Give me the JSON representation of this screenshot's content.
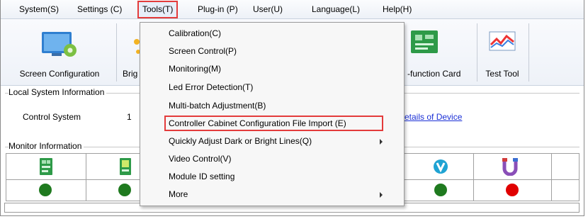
{
  "menubar": {
    "items": [
      "System(S)",
      "Settings (C)",
      "Tools(T)",
      "Plug-in (P)",
      "User(U)",
      "Language(L)",
      "Help(H)"
    ]
  },
  "toolbar": {
    "screen_configuration": "Screen Configuration",
    "brightness_partial": "Brig",
    "multifunction_partial": "-function Card",
    "test_tool": "Test Tool"
  },
  "local_system": {
    "title": "Local System Information",
    "control_system_label": "Control System",
    "control_system_value": "1",
    "details_link_partial": "etails of Device"
  },
  "monitor": {
    "title": "Monitor Information",
    "status_colors": [
      "#1f7a1f",
      "#1f7a1f",
      "#1f7a1f",
      "#e00000"
    ]
  },
  "tools_menu": {
    "items": [
      {
        "label": "Calibration(C)",
        "submenu": false
      },
      {
        "label": "Screen Control(P)",
        "submenu": false
      },
      {
        "label": "Monitoring(M)",
        "submenu": false
      },
      {
        "label": "Led Error Detection(T)",
        "submenu": false
      },
      {
        "label": "Multi-batch Adjustment(B)",
        "submenu": false
      },
      {
        "label": "Controller Cabinet Configuration File Import (E)",
        "submenu": false,
        "highlighted": true
      },
      {
        "label": "Quickly Adjust Dark or Bright Lines(Q)",
        "submenu": true
      },
      {
        "label": "Video Control(V)",
        "submenu": false
      },
      {
        "label": "Module ID setting",
        "submenu": false
      },
      {
        "label": "More",
        "submenu": true
      }
    ]
  },
  "colors": {
    "highlight_border": "#e33b3b",
    "link": "#1a2fd6",
    "status_green": "#1f7a1f",
    "status_red": "#e00000"
  }
}
